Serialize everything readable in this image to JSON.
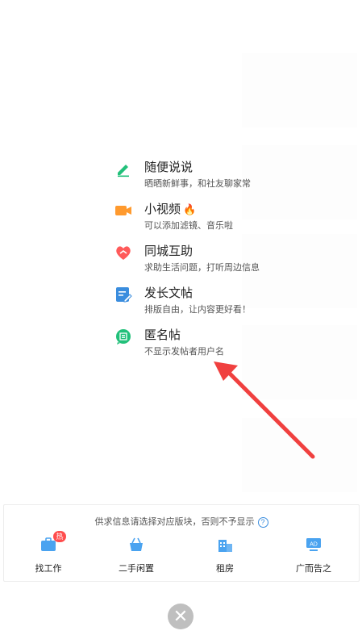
{
  "colors": {
    "accent_green": "#22c07a",
    "video_orange": "#ff9a2e",
    "help_red": "#ff5a5a",
    "article_blue": "#3a8dde",
    "arrow_red": "#f0403f",
    "close_gray": "#bfbfbf",
    "job_blue": "#4aa3f0"
  },
  "menu": {
    "items": [
      {
        "title": "随便说说",
        "subtitle": "晒晒新鲜事，和社友聊家常",
        "icon": "pencil-icon"
      },
      {
        "title": "小视频",
        "subtitle": "可以添加滤镜、音乐啦",
        "icon": "video-camera-icon",
        "badge_icon": "fire-icon"
      },
      {
        "title": "同城互助",
        "subtitle": "求助生活问题，打听周边信息",
        "icon": "heart-hand-icon"
      },
      {
        "title": "发长文帖",
        "subtitle": "排版自由，让内容更好看！",
        "icon": "document-edit-icon"
      },
      {
        "title": "匿名帖",
        "subtitle": "不显示发帖者用户名",
        "icon": "anonymous-chat-icon"
      }
    ]
  },
  "bottom_card": {
    "notice": "供求信息请选择对应版块，否则不予显示",
    "categories": [
      {
        "label": "找工作",
        "icon": "briefcase-icon",
        "badge": "热"
      },
      {
        "label": "二手闲置",
        "icon": "basket-icon"
      },
      {
        "label": "租房",
        "icon": "building-icon"
      },
      {
        "label": "广而告之",
        "icon": "ad-board-icon",
        "icon_text": "AD"
      }
    ]
  },
  "close_button": {
    "glyph": "✕"
  }
}
